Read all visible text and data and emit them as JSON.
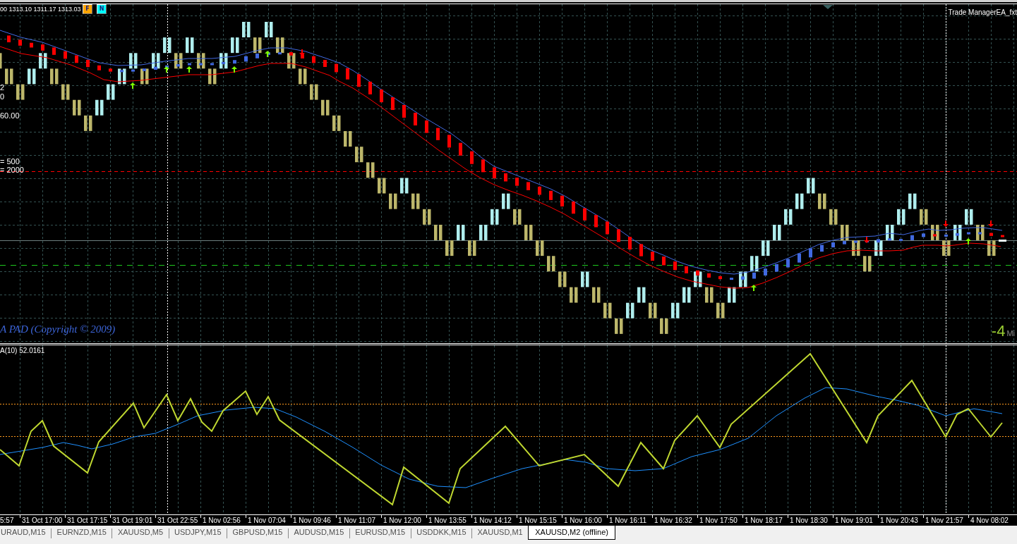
{
  "chart_window": {
    "ohlc_readout": "00 1313.10 1311.17 1313.03",
    "toolbar_buttons": [
      {
        "label": "F",
        "color": "#ffa500"
      },
      {
        "label": "N",
        "color": "#00ffff"
      }
    ],
    "expert_label": "Trade ManagerEA_fxt",
    "side_labels": [
      "2",
      "0",
      "60.00",
      "= 500",
      "= 2000"
    ],
    "copyright": "A PAD (Copyright © 2009)",
    "countdown": {
      "value": "-4",
      "unit": "Mi"
    }
  },
  "indicator_window": {
    "label": "A(10) 52.0161"
  },
  "time_axis": {
    "labels": [
      "5:57",
      "31 Oct 17:00",
      "31 Oct 17:15",
      "31 Oct 19:01",
      "31 Oct 22:55",
      "1 Nov 02:56",
      "1 Nov 07:04",
      "1 Nov 09:46",
      "1 Nov 11:07",
      "1 Nov 12:00",
      "1 Nov 13:55",
      "1 Nov 14:12",
      "1 Nov 15:15",
      "1 Nov 16:00",
      "1 Nov 16:11",
      "1 Nov 16:32",
      "1 Nov 17:50",
      "1 Nov 18:17",
      "1 Nov 18:30",
      "1 Nov 19:01",
      "1 Nov 20:43",
      "1 Nov 21:57",
      "4 Nov 08:02"
    ]
  },
  "symbol_tabs": [
    {
      "label": "URAUD,M15",
      "selected": false
    },
    {
      "label": "EURNZD,M15",
      "selected": false
    },
    {
      "label": "XAUUSD,M5",
      "selected": false
    },
    {
      "label": "USDJPY,M15",
      "selected": false
    },
    {
      "label": "GBPUSD,M15",
      "selected": false
    },
    {
      "label": "AUDUSD,M15",
      "selected": false
    },
    {
      "label": "EURUSD,M15",
      "selected": false
    },
    {
      "label": "USDDKK,M15",
      "selected": false
    },
    {
      "label": "XAUUSD,M1",
      "selected": false
    },
    {
      "label": "XAUUSD,M2 (offline)",
      "selected": true
    }
  ]
}
